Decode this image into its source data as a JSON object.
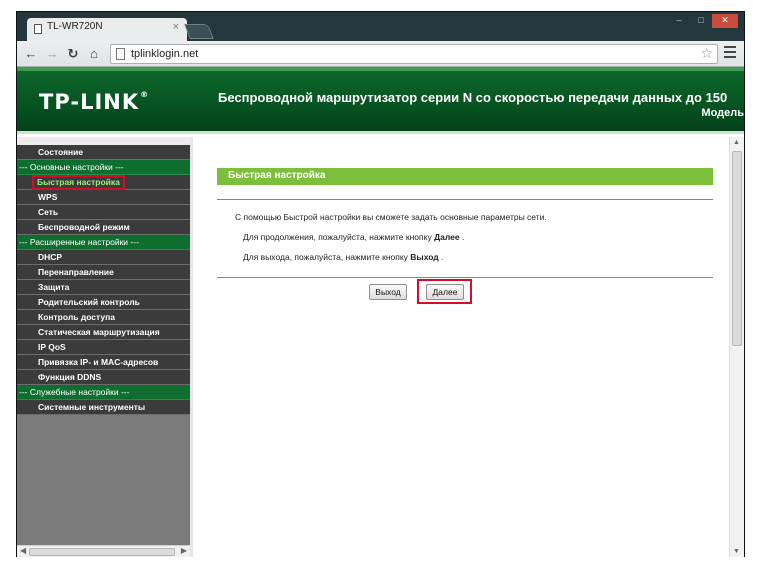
{
  "browser": {
    "tab_title": "TL-WR720N",
    "tab_close": "×",
    "url": "tplinklogin.net",
    "window_controls": [
      "–",
      "□",
      "✕"
    ]
  },
  "header": {
    "logo": "TP-LINK",
    "logo_mark": "®",
    "title": "Беспроводной маршрутизатор серии N со скоростью передачи данных до 150",
    "model": "Модель"
  },
  "sidebar": {
    "items": [
      {
        "label": "Состояние",
        "type": "item"
      },
      {
        "label": "--- Основные настройки ---",
        "type": "section"
      },
      {
        "label": "Быстрая настройка",
        "type": "active"
      },
      {
        "label": "WPS",
        "type": "item"
      },
      {
        "label": "Сеть",
        "type": "item"
      },
      {
        "label": "Беспроводной режим",
        "type": "item"
      },
      {
        "label": "--- Расширенные настройки ---",
        "type": "section"
      },
      {
        "label": "DHCP",
        "type": "item"
      },
      {
        "label": "Перенаправление",
        "type": "item"
      },
      {
        "label": "Защита",
        "type": "item"
      },
      {
        "label": "Родительский контроль",
        "type": "item"
      },
      {
        "label": "Контроль доступа",
        "type": "item"
      },
      {
        "label": "Статическая маршрутизация",
        "type": "item"
      },
      {
        "label": "IP QoS",
        "type": "item"
      },
      {
        "label": "Привязка IP- и MAC-адресов",
        "type": "item"
      },
      {
        "label": "Функция DDNS",
        "type": "item"
      },
      {
        "label": "--- Служебные настройки ---",
        "type": "section"
      },
      {
        "label": "Системные инструменты",
        "type": "item"
      }
    ]
  },
  "main": {
    "section_title": "Быстрая настройка",
    "intro": "С помощью Быстрой настройки вы сможете задать основные параметры сети.",
    "continue_text": "Для продолжения, пожалуйста, нажмите кнопку",
    "continue_button_ref": "Далее",
    "exit_text": "Для выхода, пожалуйста, нажмите кнопку",
    "exit_button_ref": "Выход",
    "exit_button": "Выход",
    "next_button": "Далее"
  },
  "colors": {
    "header_green": "#064f20",
    "section_green": "#0e6e2f",
    "title_bar_green": "#7cbf3b",
    "active_item_text": "#9cf07c",
    "highlight_red": "#d0102a"
  }
}
